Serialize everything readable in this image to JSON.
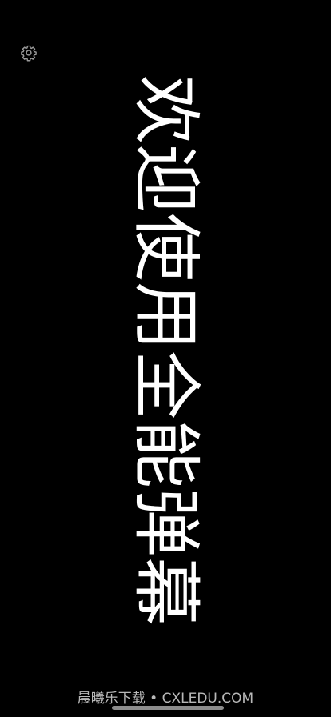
{
  "toolbar": {
    "settings_icon": "gear-icon"
  },
  "danmaku": {
    "text": "欢迎使用全能弹幕",
    "text_color": "#ffffff",
    "background_color": "#000000",
    "orientation": "vertical"
  },
  "watermark": {
    "text": "晨曦乐下载 • CXLEDU.COM"
  }
}
